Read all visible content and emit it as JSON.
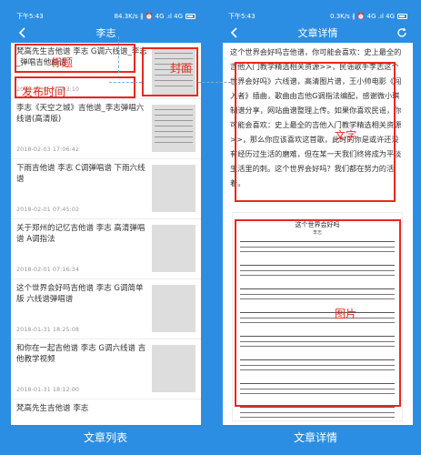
{
  "left": {
    "status": {
      "time": "下午5:43",
      "net": "84.3K/s ∦ ⏰ 4G .ıl 4G",
      "battery": "61"
    },
    "title": "李志",
    "items": [
      {
        "title": "梵高先生吉他谱 李志 G调六线谱_李志_弹唱吉他曲谱",
        "date": "2018-02-05 07:03:10"
      },
      {
        "title": "李志《天空之城》吉他谱_李志弹唱六线谱(高清版)",
        "date": "2018-02-03 17:06:42"
      },
      {
        "title": "下雨吉他谱 李志 C调弹唱谱 下雨六线谱",
        "date": "2018-02-01 07:45:02"
      },
      {
        "title": "关于郑州的记忆吉他谱 李志 高清弹唱谱 A调指法",
        "date": "2018-02-01 07:16:34"
      },
      {
        "title": "这个世界会好吗吉他谱 李志 G调简单版 六线谱弹唱谱",
        "date": "2018-01-31 18:25:08"
      },
      {
        "title": "和你在一起吉他谱 李志 G调六线谱 吉他教学视频",
        "date": "2018-01-31 18:12:00"
      },
      {
        "title": "梵高先生吉他谱 李志",
        "date": ""
      }
    ],
    "annotations": {
      "title": "标题",
      "date": "发布时间",
      "cover": "封面"
    },
    "caption": "文章列表"
  },
  "right": {
    "status": {
      "time": "下午5:43",
      "net": "0.3K/s ∦ ⏰ 4G .ıl 4G",
      "battery": "61"
    },
    "title": "文章详情",
    "body": "这个世界会好吗吉他谱，你可能会喜欢：史上最全的吉他入门教学精选相关资源>>，民谣歌手李志这个世界会好吗》六线谱，高清图片谱，王小帅电影《闯入者》插曲，歌曲由吉他G调指法编配，感谢微小琪制谱分享，网站曲谱整理上传。如果你喜欢民谣，你可能会喜欢：史上最全的吉他入门教学精选相关资源>>，那么你应该喜欢这首歌，此时的你是或许还没有经历过生活的磨难，但在某一天我们终将成为平淡生活里的刺。这个世界会好吗？我们都在努力的活着。",
    "sheet": {
      "title": "这个世界会好吗",
      "artist": "李志"
    },
    "annotations": {
      "text": "文字",
      "image": "图片"
    },
    "caption": "文章详情"
  },
  "colors": {
    "accent": "#2b8ee3",
    "annotation": "#e8281e"
  }
}
